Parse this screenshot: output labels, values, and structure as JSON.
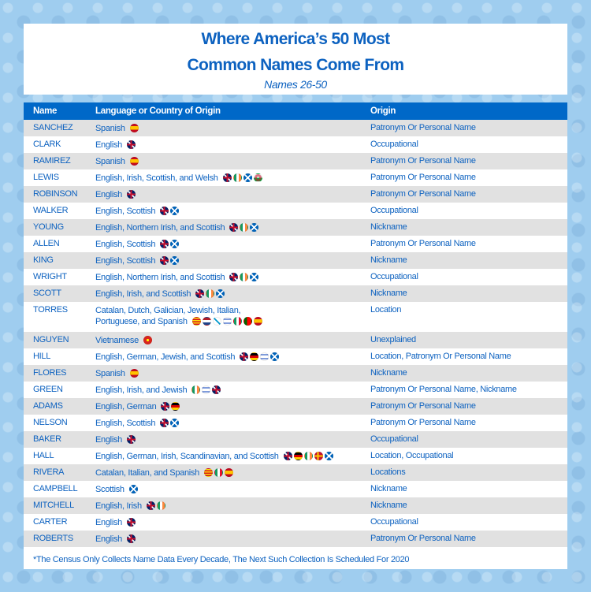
{
  "title_line1": "Where America’s 50 Most",
  "title_line2": "Common Names Come From",
  "subtitle": "Names 26-50",
  "headers": {
    "name": "Name",
    "language": "Language or Country of Origin",
    "origin": "Origin"
  },
  "rows": [
    {
      "name": "SANCHEZ",
      "language": "Spanish",
      "flags": [
        "es"
      ],
      "origin": "Patronym Or Personal Name"
    },
    {
      "name": "CLARK",
      "language": "English",
      "flags": [
        "uk"
      ],
      "origin": "Occupational"
    },
    {
      "name": "RAMIREZ",
      "language": "Spanish",
      "flags": [
        "es"
      ],
      "origin": "Patronym Or Personal Name"
    },
    {
      "name": "LEWIS",
      "language": "English, Irish, Scottish, and Welsh",
      "flags": [
        "uk",
        "ie",
        "sct",
        "wls"
      ],
      "origin": "Patronym Or Personal Name"
    },
    {
      "name": "ROBINSON",
      "language": "English",
      "flags": [
        "uk"
      ],
      "origin": "Patronym Or Personal Name"
    },
    {
      "name": "WALKER",
      "language": "English, Scottish",
      "flags": [
        "uk",
        "sct"
      ],
      "origin": "Occupational"
    },
    {
      "name": "YOUNG",
      "language": "English, Northern Irish, and Scottish",
      "flags": [
        "uk",
        "ie",
        "sct"
      ],
      "origin": "Nickname"
    },
    {
      "name": "ALLEN",
      "language": "English, Scottish",
      "flags": [
        "uk",
        "sct"
      ],
      "origin": "Patronym Or Personal Name"
    },
    {
      "name": "KING",
      "language": "English, Scottish",
      "flags": [
        "uk",
        "sct"
      ],
      "origin": "Nickname"
    },
    {
      "name": "WRIGHT",
      "language": "English, Northern Irish, and Scottish",
      "flags": [
        "uk",
        "ie",
        "sct"
      ],
      "origin": "Occupational"
    },
    {
      "name": "SCOTT",
      "language": "English, Irish, and Scottish",
      "flags": [
        "uk",
        "ie",
        "sct"
      ],
      "origin": "Nickname"
    },
    {
      "name": "TORRES",
      "language": "Catalan, Dutch, Galician, Jewish, Italian,",
      "language2": "Portuguese, and Spanish",
      "flags": [
        "cat",
        "nl",
        "gal",
        "il",
        "it",
        "pt",
        "es"
      ],
      "origin": "Location"
    },
    {
      "name": "NGUYEN",
      "language": "Vietnamese",
      "flags": [
        "vn"
      ],
      "origin": "Unexplained"
    },
    {
      "name": "HILL",
      "language": "English, German, Jewish, and Scottish",
      "flags": [
        "uk",
        "de",
        "il",
        "sct"
      ],
      "origin": "Location, Patronym Or Personal Name"
    },
    {
      "name": "FLORES",
      "language": "Spanish",
      "flags": [
        "es"
      ],
      "origin": "Nickname"
    },
    {
      "name": "GREEN",
      "language": "English, Irish, and Jewish",
      "flags": [
        "ie",
        "il",
        "uk"
      ],
      "origin": "Patronym Or Personal Name, Nickname"
    },
    {
      "name": "ADAMS",
      "language": "English, German",
      "flags": [
        "uk",
        "de"
      ],
      "origin": "Patronym Or Personal Name"
    },
    {
      "name": "NELSON",
      "language": "English, Scottish",
      "flags": [
        "uk",
        "sct"
      ],
      "origin": "Patronym Or Personal Name"
    },
    {
      "name": "BAKER",
      "language": "English",
      "flags": [
        "uk"
      ],
      "origin": "Occupational"
    },
    {
      "name": "HALL",
      "language": "English, German, Irish, Scandinavian, and Scottish",
      "flags": [
        "uk",
        "de",
        "ie",
        "sca",
        "sct"
      ],
      "origin": "Location, Occupational"
    },
    {
      "name": "RIVERA",
      "language": "Catalan, Italian, and Spanish",
      "flags": [
        "cat",
        "it",
        "es"
      ],
      "origin": "Locations"
    },
    {
      "name": "CAMPBELL",
      "language": "Scottish",
      "flags": [
        "sct"
      ],
      "origin": "Nickname"
    },
    {
      "name": "MITCHELL",
      "language": "English, Irish",
      "flags": [
        "uk",
        "ie"
      ],
      "origin": "Nickname"
    },
    {
      "name": "CARTER",
      "language": "English",
      "flags": [
        "uk"
      ],
      "origin": "Occupational"
    },
    {
      "name": "ROBERTS",
      "language": "English",
      "flags": [
        "uk"
      ],
      "origin": "Patronym Or Personal Name"
    }
  ],
  "footnote": "*The Census Only Collects Name Data Every Decade, The Next Such Collection Is Scheduled For 2020",
  "colors": {
    "accent": "#0068c8",
    "text": "#0d62c0",
    "row_alt": "#e1e1e1",
    "background": "#9fcdef"
  }
}
